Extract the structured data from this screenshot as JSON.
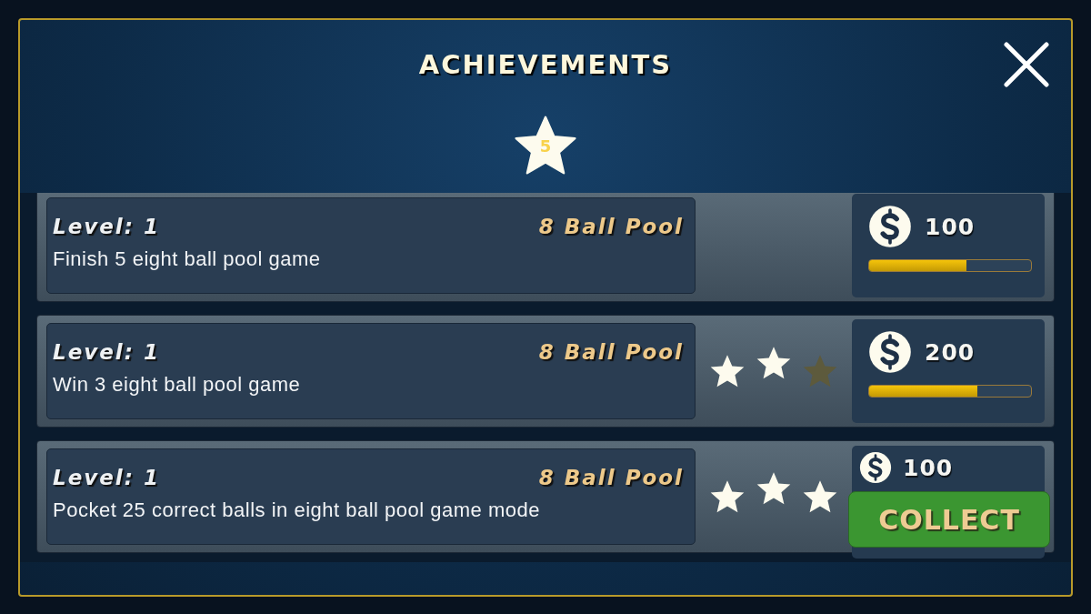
{
  "title": "ACHIEVEMENTS",
  "star_count": "5",
  "achievements": [
    {
      "kind": "progress",
      "level_label": "Level: 1",
      "game": "8 Ball Pool",
      "description": "Finish 5 eight ball pool game",
      "reward": "100",
      "level": 0.6
    },
    {
      "kind": "progress",
      "level_label": "Level: 1",
      "game": "8 Ball Pool",
      "description": "Win 3 eight ball pool game",
      "stars": 2,
      "reward": "200",
      "level": 0.67
    },
    {
      "kind": "collect",
      "level_label": "Level: 1",
      "game": "8 Ball Pool",
      "description": "Pocket 25 correct balls in eight ball pool game mode",
      "stars": 3,
      "reward": "100",
      "button": "COLLECT"
    }
  ]
}
